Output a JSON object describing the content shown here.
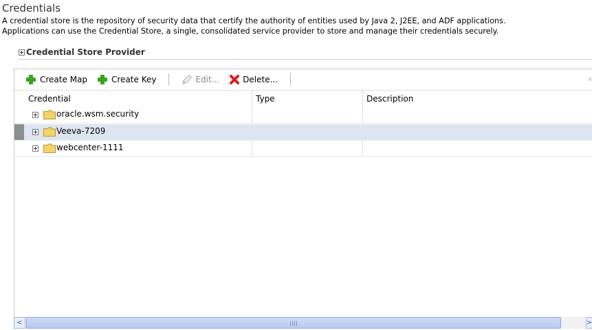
{
  "page": {
    "title": "Credentials",
    "description_line1": "A credential store is the repository of security data that certify the authority of entities used by Java 2, J2EE, and ADF applications.",
    "description_line2": "Applications can use the Credential Store, a single, consolidated service provider to store and manage their credentials securely."
  },
  "provider_section": {
    "label": "Credential Store Provider",
    "expanded": false
  },
  "toolbar": {
    "create_map": "Create Map",
    "create_key": "Create Key",
    "edit": "Edit...",
    "delete": "Delete...",
    "close_glyph": "×"
  },
  "table": {
    "columns": [
      "Credential",
      "Type",
      "Description"
    ],
    "rows": [
      {
        "name": "oracle.wsm.security",
        "type": "",
        "description": "",
        "selected": false
      },
      {
        "name": "Veeva-7209",
        "type": "",
        "description": "",
        "selected": true
      },
      {
        "name": "webcenter-1111",
        "type": "",
        "description": "",
        "selected": false
      }
    ]
  },
  "scrollbar": {
    "left_arrow": "<",
    "right_arrow": ">"
  },
  "colors": {
    "selection": "#dde6f0",
    "add_icon": "#3aa41c",
    "delete_icon": "#d9201a",
    "folder": "#f3d36b",
    "scroll_thumb": "#b7cbf1"
  }
}
